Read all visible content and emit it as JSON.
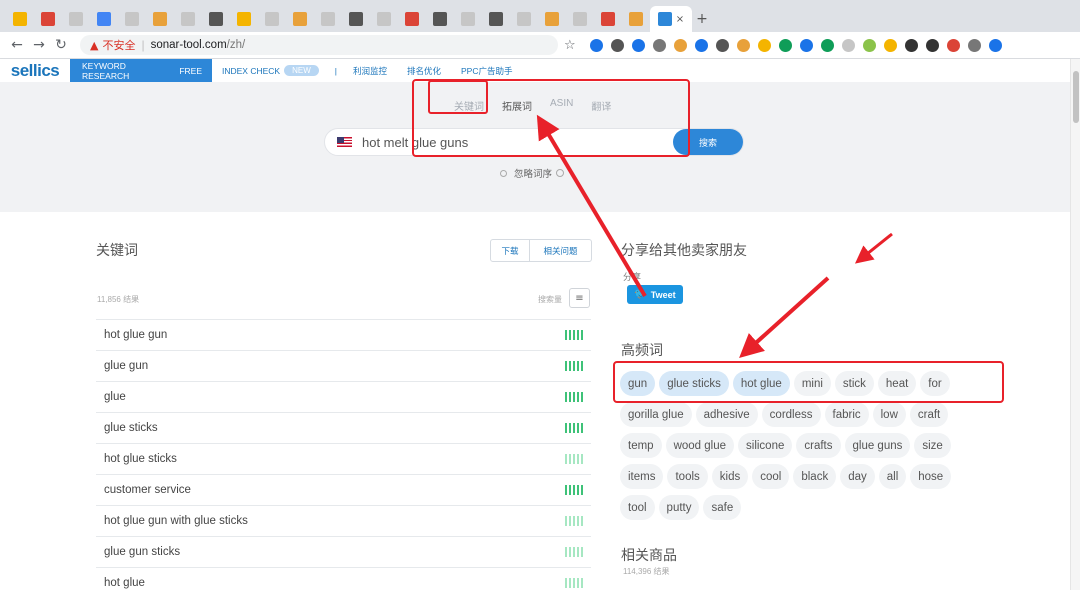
{
  "browser": {
    "tab_close_glyph": "×",
    "new_tab_glyph": "+",
    "tab_favicons": [
      "#f4b400",
      "#db4437",
      "#c6c6c6",
      "#4285f4",
      "#c6c6c6",
      "#e8a13a",
      "#c6c6c6",
      "#555555",
      "#f4b400",
      "#c6c6c6",
      "#e8a13a",
      "#c6c6c6",
      "#555555",
      "#c6c6c6",
      "#db4437",
      "#555555",
      "#c6c6c6",
      "#555555",
      "#c6c6c6",
      "#e8a13a",
      "#c6c6c6",
      "#db4437",
      "#e8a13a",
      "#2d87d8"
    ],
    "insecure_label": "不安全",
    "url": "sonar-tool.com",
    "url_path": "/zh/",
    "extension_colors": [
      "#1a73e8",
      "#555555",
      "#1a73e8",
      "#777777",
      "#e8a13a",
      "#1a73e8",
      "#555555",
      "#e8a13a",
      "#f4b400",
      "#0f9d58",
      "#1a73e8",
      "#0f9d58",
      "#c6c6c6",
      "#8bc34a",
      "#f4b400",
      "#333333",
      "#333333",
      "#db4437",
      "#777777",
      "#1a73e8"
    ]
  },
  "sitenav": {
    "logo": "sellics",
    "active_item": "KEYWORD RESEARCH",
    "active_item_badge": "FREE",
    "items": [
      {
        "label": "INDEX CHECK",
        "badge": "NEW"
      },
      {
        "label": "|"
      },
      {
        "label": "利润监控"
      },
      {
        "label": "排名优化"
      },
      {
        "label": "PPC广告助手"
      }
    ]
  },
  "hero": {
    "mode_tabs": [
      "关键词",
      "拓展词",
      "ASIN",
      "翻译"
    ],
    "active_mode": 1,
    "search_value": "hot melt glue guns",
    "search_button": "搜索",
    "ignore_order": "忽略词序"
  },
  "keywords": {
    "title": "关键词",
    "download_button": "下载",
    "related_button": "相关问题",
    "result_count": "11,856 结果",
    "sort_label": "搜索量",
    "rows": [
      {
        "keyword": "hot glue gun",
        "level": "high"
      },
      {
        "keyword": "glue gun",
        "level": "high"
      },
      {
        "keyword": "glue",
        "level": "high"
      },
      {
        "keyword": "glue sticks",
        "level": "high"
      },
      {
        "keyword": "hot glue sticks",
        "level": "low"
      },
      {
        "keyword": "customer service",
        "level": "high"
      },
      {
        "keyword": "hot glue gun with glue sticks",
        "level": "low"
      },
      {
        "keyword": "glue gun sticks",
        "level": "low"
      },
      {
        "keyword": "hot glue",
        "level": "low"
      }
    ]
  },
  "share": {
    "title": "分享给其他卖家朋友",
    "subtitle": "分享",
    "tweet_label": "Tweet"
  },
  "frequent": {
    "title": "高频词",
    "highlighted": [
      "gun",
      "glue sticks",
      "hot glue"
    ],
    "tags": [
      "gun",
      "glue sticks",
      "hot glue",
      "mini",
      "stick",
      "heat",
      "for",
      "gorilla glue",
      "adhesive",
      "cordless",
      "fabric",
      "low",
      "craft",
      "temp",
      "wood glue",
      "silicone",
      "crafts",
      "glue guns",
      "size",
      "items",
      "tools",
      "kids",
      "cool",
      "black",
      "day",
      "all",
      "hose",
      "tool",
      "putty",
      "safe"
    ]
  },
  "related_products": {
    "title": "相关商品",
    "count": "114,396 结果"
  },
  "annotation_color": "#e8212a"
}
